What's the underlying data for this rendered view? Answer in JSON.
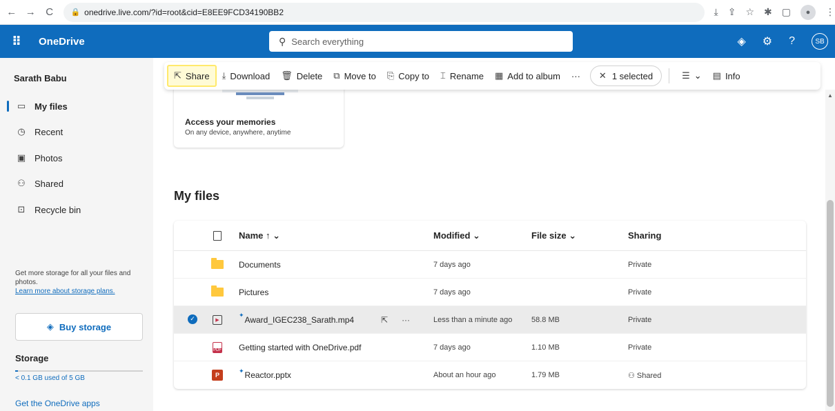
{
  "browser": {
    "url": "onedrive.live.com/?id=root&cid=E8EE9FCD34190BB2",
    "back_icon": "←",
    "forward_icon": "→",
    "reload_icon": "C"
  },
  "header": {
    "brand": "OneDrive",
    "search_placeholder": "Search everything",
    "avatar_initials": "SB",
    "accent_color": "#0f6cbd"
  },
  "sidebar": {
    "user_name": "Sarath Babu",
    "items": [
      {
        "label": "My files",
        "icon": "folder-icon"
      },
      {
        "label": "Recent",
        "icon": "history-icon"
      },
      {
        "label": "Photos",
        "icon": "photo-icon"
      },
      {
        "label": "Shared",
        "icon": "people-icon"
      },
      {
        "label": "Recycle bin",
        "icon": "recycle-bin-icon"
      }
    ],
    "promo_text": "Get more storage for all your files and photos.",
    "promo_link": "Learn more about storage plans.",
    "buy_storage": "Buy storage",
    "storage_title": "Storage",
    "storage_used": "< 0.1 GB used of 5 GB",
    "storage_fraction": 0.02,
    "get_apps": "Get the OneDrive apps"
  },
  "memories": {
    "title": "Access your memories",
    "subtitle": "On any device, anywhere, anytime"
  },
  "toolbar": {
    "share": "Share",
    "download": "Download",
    "delete": "Delete",
    "move_to": "Move to",
    "copy_to": "Copy to",
    "rename": "Rename",
    "add_to_album": "Add to album",
    "more": "···",
    "selected": "1 selected",
    "info": "Info"
  },
  "main": {
    "section_title": "My files"
  },
  "table": {
    "headers": {
      "name": "Name ↑ ⌄",
      "modified": "Modified ⌄",
      "size": "File size ⌄",
      "sharing": "Sharing"
    },
    "rows": [
      {
        "name": "Documents",
        "modified": "7 days ago",
        "size": "",
        "sharing": "Private",
        "type": "folder"
      },
      {
        "name": "Pictures",
        "modified": "7 days ago",
        "size": "",
        "sharing": "Private",
        "type": "folder"
      },
      {
        "name": "Award_IGEC238_Sarath.mp4",
        "modified": "Less than a minute ago",
        "size": "58.8 MB",
        "sharing": "Private",
        "type": "video"
      },
      {
        "name": "Getting started with OneDrive.pdf",
        "modified": "7 days ago",
        "size": "1.10 MB",
        "sharing": "Private",
        "type": "pdf"
      },
      {
        "name": "Reactor.pptx",
        "modified": "About an hour ago",
        "size": "1.79 MB",
        "sharing": "Shared",
        "type": "pptx"
      }
    ]
  }
}
